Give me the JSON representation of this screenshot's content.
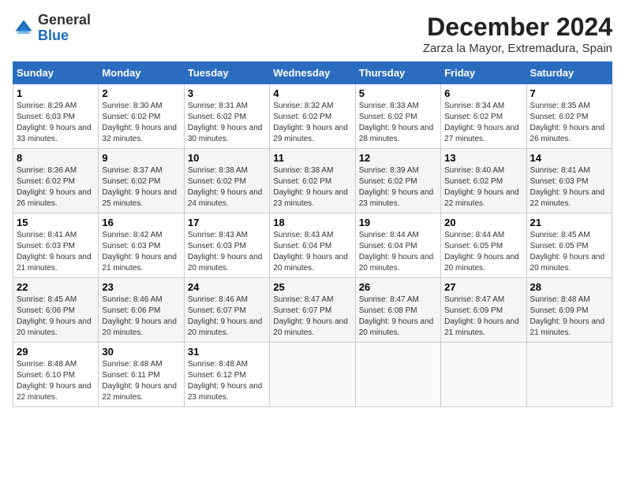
{
  "header": {
    "logo_general": "General",
    "logo_blue": "Blue",
    "month_year": "December 2024",
    "location": "Zarza la Mayor, Extremadura, Spain"
  },
  "weekdays": [
    "Sunday",
    "Monday",
    "Tuesday",
    "Wednesday",
    "Thursday",
    "Friday",
    "Saturday"
  ],
  "weeks": [
    [
      {
        "day": "1",
        "sunrise": "8:29 AM",
        "sunset": "6:03 PM",
        "daylight": "9 hours and 33 minutes."
      },
      {
        "day": "2",
        "sunrise": "8:30 AM",
        "sunset": "6:02 PM",
        "daylight": "9 hours and 32 minutes."
      },
      {
        "day": "3",
        "sunrise": "8:31 AM",
        "sunset": "6:02 PM",
        "daylight": "9 hours and 30 minutes."
      },
      {
        "day": "4",
        "sunrise": "8:32 AM",
        "sunset": "6:02 PM",
        "daylight": "9 hours and 29 minutes."
      },
      {
        "day": "5",
        "sunrise": "8:33 AM",
        "sunset": "6:02 PM",
        "daylight": "9 hours and 28 minutes."
      },
      {
        "day": "6",
        "sunrise": "8:34 AM",
        "sunset": "6:02 PM",
        "daylight": "9 hours and 27 minutes."
      },
      {
        "day": "7",
        "sunrise": "8:35 AM",
        "sunset": "6:02 PM",
        "daylight": "9 hours and 26 minutes."
      }
    ],
    [
      {
        "day": "8",
        "sunrise": "8:36 AM",
        "sunset": "6:02 PM",
        "daylight": "9 hours and 26 minutes."
      },
      {
        "day": "9",
        "sunrise": "8:37 AM",
        "sunset": "6:02 PM",
        "daylight": "9 hours and 25 minutes."
      },
      {
        "day": "10",
        "sunrise": "8:38 AM",
        "sunset": "6:02 PM",
        "daylight": "9 hours and 24 minutes."
      },
      {
        "day": "11",
        "sunrise": "8:38 AM",
        "sunset": "6:02 PM",
        "daylight": "9 hours and 23 minutes."
      },
      {
        "day": "12",
        "sunrise": "8:39 AM",
        "sunset": "6:02 PM",
        "daylight": "9 hours and 23 minutes."
      },
      {
        "day": "13",
        "sunrise": "8:40 AM",
        "sunset": "6:02 PM",
        "daylight": "9 hours and 22 minutes."
      },
      {
        "day": "14",
        "sunrise": "8:41 AM",
        "sunset": "6:03 PM",
        "daylight": "9 hours and 22 minutes."
      }
    ],
    [
      {
        "day": "15",
        "sunrise": "8:41 AM",
        "sunset": "6:03 PM",
        "daylight": "9 hours and 21 minutes."
      },
      {
        "day": "16",
        "sunrise": "8:42 AM",
        "sunset": "6:03 PM",
        "daylight": "9 hours and 21 minutes."
      },
      {
        "day": "17",
        "sunrise": "8:43 AM",
        "sunset": "6:03 PM",
        "daylight": "9 hours and 20 minutes."
      },
      {
        "day": "18",
        "sunrise": "8:43 AM",
        "sunset": "6:04 PM",
        "daylight": "9 hours and 20 minutes."
      },
      {
        "day": "19",
        "sunrise": "8:44 AM",
        "sunset": "6:04 PM",
        "daylight": "9 hours and 20 minutes."
      },
      {
        "day": "20",
        "sunrise": "8:44 AM",
        "sunset": "6:05 PM",
        "daylight": "9 hours and 20 minutes."
      },
      {
        "day": "21",
        "sunrise": "8:45 AM",
        "sunset": "6:05 PM",
        "daylight": "9 hours and 20 minutes."
      }
    ],
    [
      {
        "day": "22",
        "sunrise": "8:45 AM",
        "sunset": "6:06 PM",
        "daylight": "9 hours and 20 minutes."
      },
      {
        "day": "23",
        "sunrise": "8:46 AM",
        "sunset": "6:06 PM",
        "daylight": "9 hours and 20 minutes."
      },
      {
        "day": "24",
        "sunrise": "8:46 AM",
        "sunset": "6:07 PM",
        "daylight": "9 hours and 20 minutes."
      },
      {
        "day": "25",
        "sunrise": "8:47 AM",
        "sunset": "6:07 PM",
        "daylight": "9 hours and 20 minutes."
      },
      {
        "day": "26",
        "sunrise": "8:47 AM",
        "sunset": "6:08 PM",
        "daylight": "9 hours and 20 minutes."
      },
      {
        "day": "27",
        "sunrise": "8:47 AM",
        "sunset": "6:09 PM",
        "daylight": "9 hours and 21 minutes."
      },
      {
        "day": "28",
        "sunrise": "8:48 AM",
        "sunset": "6:09 PM",
        "daylight": "9 hours and 21 minutes."
      }
    ],
    [
      {
        "day": "29",
        "sunrise": "8:48 AM",
        "sunset": "6:10 PM",
        "daylight": "9 hours and 22 minutes."
      },
      {
        "day": "30",
        "sunrise": "8:48 AM",
        "sunset": "6:11 PM",
        "daylight": "9 hours and 22 minutes."
      },
      {
        "day": "31",
        "sunrise": "8:48 AM",
        "sunset": "6:12 PM",
        "daylight": "9 hours and 23 minutes."
      },
      null,
      null,
      null,
      null
    ]
  ]
}
